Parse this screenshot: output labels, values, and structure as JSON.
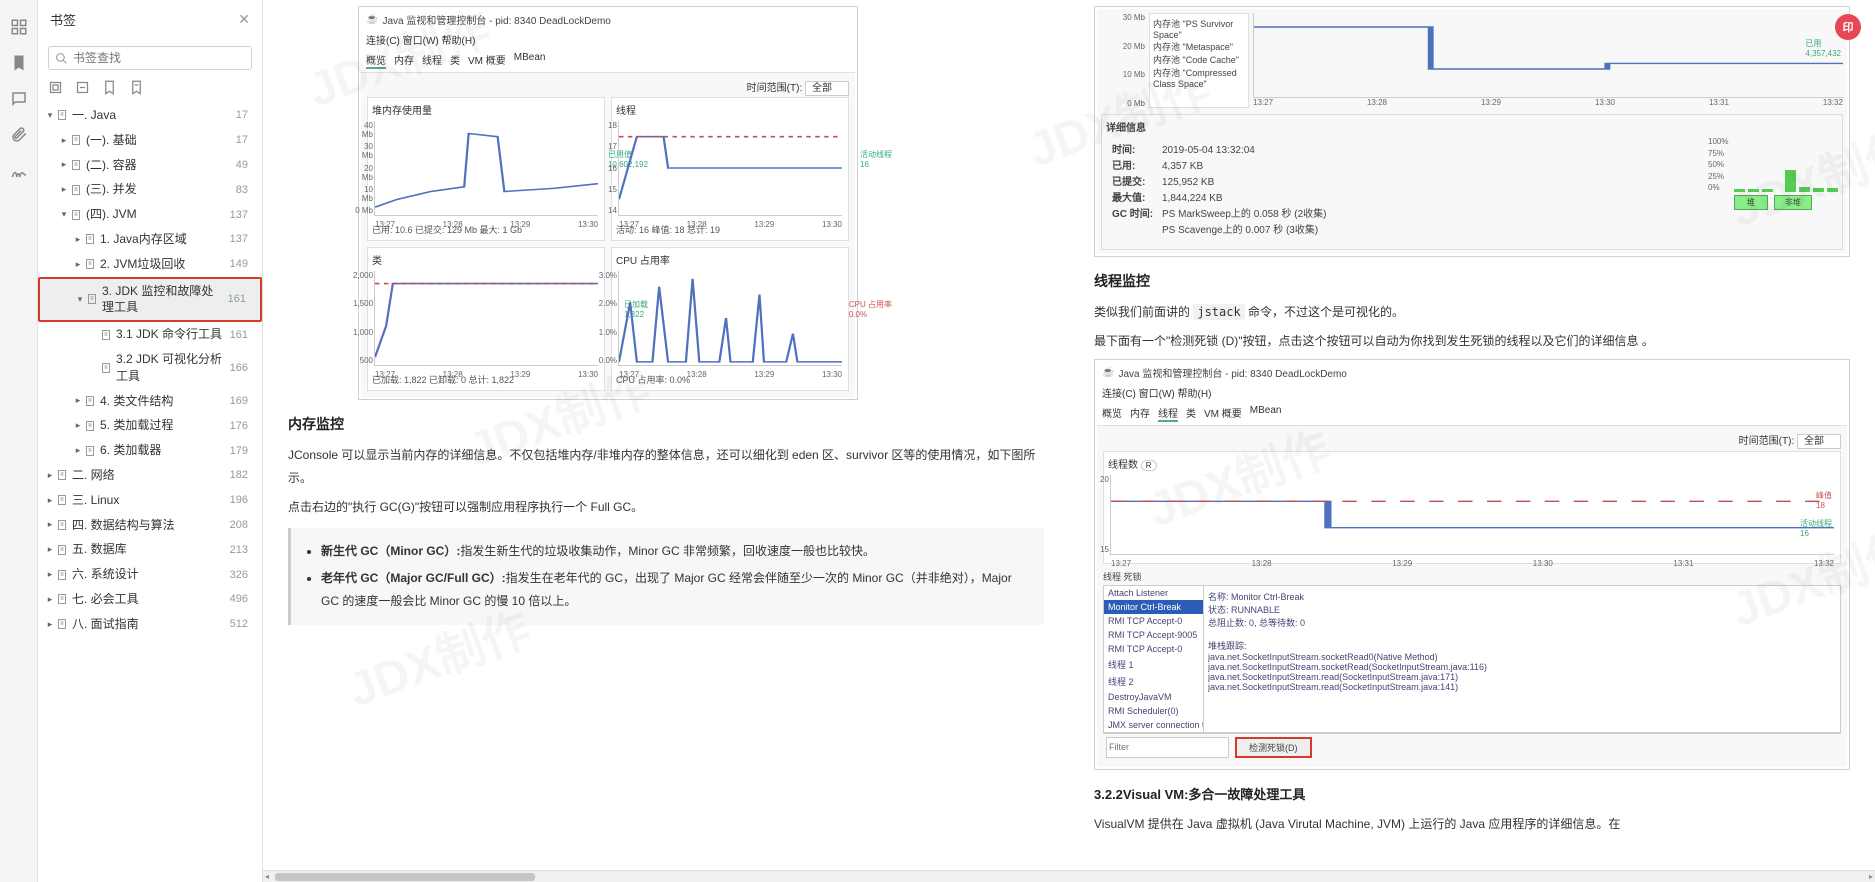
{
  "sidebar": {
    "title": "书签",
    "search_placeholder": "书签查找",
    "items": [
      {
        "l": 0,
        "a": "open",
        "label": "一.  Java",
        "count": 17
      },
      {
        "l": 1,
        "a": "closed",
        "label": "(一). 基础",
        "count": 17
      },
      {
        "l": 1,
        "a": "closed",
        "label": "(二). 容器",
        "count": 49
      },
      {
        "l": 1,
        "a": "closed",
        "label": "(三). 并发",
        "count": 83
      },
      {
        "l": 1,
        "a": "open",
        "label": "(四). JVM",
        "count": 137
      },
      {
        "l": 2,
        "a": "closed",
        "label": "1. Java内存区域",
        "count": 137
      },
      {
        "l": 2,
        "a": "closed",
        "label": "2. JVM垃圾回收",
        "count": 149
      },
      {
        "l": 2,
        "a": "open",
        "label": "3. JDK 监控和故障处理工具",
        "count": 161,
        "sel": true
      },
      {
        "l": 3,
        "a": "none",
        "label": "3.1 JDK 命令行工具",
        "count": 161
      },
      {
        "l": 3,
        "a": "none",
        "label": "3.2 JDK 可视化分析工具",
        "count": 166
      },
      {
        "l": 2,
        "a": "closed",
        "label": "4. 类文件结构",
        "count": 169
      },
      {
        "l": 2,
        "a": "closed",
        "label": "5. 类加载过程",
        "count": 176
      },
      {
        "l": 2,
        "a": "closed",
        "label": "6. 类加载器",
        "count": 179
      },
      {
        "l": 0,
        "a": "closed",
        "label": "二.  网络",
        "count": 182
      },
      {
        "l": 0,
        "a": "closed",
        "label": "三.  Linux",
        "count": 196
      },
      {
        "l": 0,
        "a": "closed",
        "label": "四.  数据结构与算法",
        "count": 208
      },
      {
        "l": 0,
        "a": "closed",
        "label": "五.  数据库",
        "count": 213
      },
      {
        "l": 0,
        "a": "closed",
        "label": "六.  系统设计",
        "count": 326
      },
      {
        "l": 0,
        "a": "closed",
        "label": "七.  必会工具",
        "count": 496
      },
      {
        "l": 0,
        "a": "closed",
        "label": "八.  面试指南",
        "count": 512
      }
    ]
  },
  "col1": {
    "fig1": {
      "title": "Java 监视和管理控制台 - pid: 8340 DeadLockDemo",
      "menu": "连接(C)  窗口(W)  帮助(H)",
      "tabs": [
        "概览",
        "内存",
        "线程",
        "类",
        "VM 概要",
        "MBean"
      ],
      "timerange_label": "时间范围(T):",
      "timerange_value": "全部",
      "charts": {
        "heap": {
          "title": "堆内存使用量",
          "yticks": [
            "40 Mb",
            "30 Mb",
            "20 Mb",
            "10 Mb",
            "0 Mb"
          ],
          "xticks": [
            "13:27",
            "13:28",
            "13:29",
            "13:30"
          ],
          "footer": "已用:  10.6   已提交:  129 Mb   最大:  1 Gb",
          "legend": "已用值\n10,602,192"
        },
        "thread": {
          "title": "线程",
          "yticks": [
            "18",
            "17",
            "16",
            "15",
            "14"
          ],
          "xticks": [
            "13:27",
            "13:28",
            "13:29",
            "13:30"
          ],
          "footer": "活动: 16     峰值: 18     总计: 19",
          "legend": "活动线程\n16"
        },
        "class": {
          "title": "类",
          "yticks": [
            "2,000",
            "1,500",
            "1,000",
            "500"
          ],
          "xticks": [
            "13:27",
            "13:28",
            "13:29",
            "13:30"
          ],
          "footer": "已加载:  1,822     已卸载:  0     总计:  1,822",
          "legend": "已加载\n1,822"
        },
        "cpu": {
          "title": "CPU 占用率",
          "yticks": [
            "3.0%",
            "2.0%",
            "1.0%",
            "0.0%"
          ],
          "xticks": [
            "13:27",
            "13:28",
            "13:29",
            "13:30"
          ],
          "footer": "CPU 占用率:  0.0%",
          "legend": "CPU 占用率\n0.0%"
        }
      }
    },
    "h_mem": "内存监控",
    "p_mem1": "JConsole 可以显示当前内存的详细信息。不仅包括堆内存/非堆内存的整体信息，还可以细化到 eden 区、survivor 区等的使用情况，如下图所示。",
    "p_mem2_a": "点击右边的\"执行 GC(G)\"按钮可以强制应用程序执行一个 Full GC。",
    "bullet1": "新生代 GC（Minor GC）:指发生新生代的垃圾收集动作，Minor GC 非常频繁，回收速度一般也比较快。",
    "bullet2": "老年代 GC（Major GC/Full GC）:指发生在老年代的 GC，出现了 Major GC 经常会伴随至少一次的 Minor GC（并非绝对），Major GC 的速度一般会比 Minor GC 的慢 10 倍以上。"
  },
  "col2": {
    "mem_lines": [
      "内存池  \"PS Survivor Space\"",
      "内存池  \"Metaspace\"",
      "内存池  \"Code Cache\"",
      "内存池  \"Compressed Class Space\""
    ],
    "mem_chart": {
      "yticks": [
        "30 Mb",
        "20 Mb",
        "10 Mb",
        "0 Mb"
      ],
      "xticks": [
        "13:27",
        "13:28",
        "13:29",
        "13:30",
        "13:31",
        "13:32"
      ],
      "legend": "已用\n4,357,432"
    },
    "details_title": "详细信息",
    "details": [
      {
        "k": "时间:",
        "v": "2019-05-04 13:32:04"
      },
      {
        "k": "已用:",
        "v": "    4,357 KB"
      },
      {
        "k": "已提交:",
        "v": "  125,952 KB"
      },
      {
        "k": "最大值:",
        "v": "1,844,224 KB"
      },
      {
        "k": "GC 时间:",
        "v": "PS MarkSweep上的            0.058 秒 (2收集)"
      },
      {
        "k": "",
        "v": "PS Scavenge上的            0.007 秒 (3收集)"
      }
    ],
    "bar_ticks": [
      "100%",
      "75%",
      "50%",
      "25%",
      "0%"
    ],
    "bar_labels": [
      "堆",
      "非堆"
    ],
    "h_thread": "线程监控",
    "p_thread1_a": "类似我们前面讲的 ",
    "p_thread1_code": "jstack",
    "p_thread1_b": " 命令，不过这个是可视化的。",
    "p_thread2": "最下面有一个\"检测死锁 (D)\"按钮，点击这个按钮可以自动为你找到发生死锁的线程以及它们的详细信息 。",
    "fig2": {
      "title": "Java 监视和管理控制台 - pid: 8340 DeadLockDemo",
      "menu": "连接(C)  窗口(W)  帮助(H)",
      "tabs": [
        "概览",
        "内存",
        "线程",
        "类",
        "VM 概要",
        "MBean"
      ],
      "timerange_label": "时间范围(T):",
      "timerange_value": "全部",
      "chart": {
        "label": "线程数",
        "yticks": [
          "20",
          "15"
        ],
        "xticks": [
          "13:27",
          "13:28",
          "13:29",
          "13:30",
          "13:31",
          "13:32"
        ],
        "legend1": "峰值\n18",
        "legend2": "活动线程\n16"
      },
      "panel_title": "线程  死锁",
      "threads": [
        "Attach Listener",
        "Monitor Ctrl-Break",
        "RMI TCP Accept-0",
        "RMI TCP Accept-9005",
        "RMI TCP Accept-0",
        "线程 1",
        "线程 2",
        "DestroyJavaVM",
        "RMI Scheduler(0)",
        "JMX server connection timeout ..."
      ],
      "thread_selected": 1,
      "right": [
        "名称:  Monitor Ctrl-Break",
        "状态:  RUNNABLE",
        "总阻止数:  0,  总等待数:  0",
        "",
        "堆栈跟踪:",
        "java.net.SocketInputStream.socketRead0(Native Method)",
        "java.net.SocketInputStream.socketRead(SocketInputStream.java:116)",
        "java.net.SocketInputStream.read(SocketInputStream.java:171)",
        "java.net.SocketInputStream.read(SocketInputStream.java:141)"
      ],
      "filter_placeholder": "Filter",
      "detect_btn": "检测死锁(D)"
    },
    "h_vvm": "3.2.2Visual VM:多合一故障处理工具",
    "p_vvm": "VisualVM 提供在 Java 虚拟机 (Java Virutal Machine, JVM) 上运行的 Java 应用程序的详细信息。在"
  },
  "badge": "印"
}
